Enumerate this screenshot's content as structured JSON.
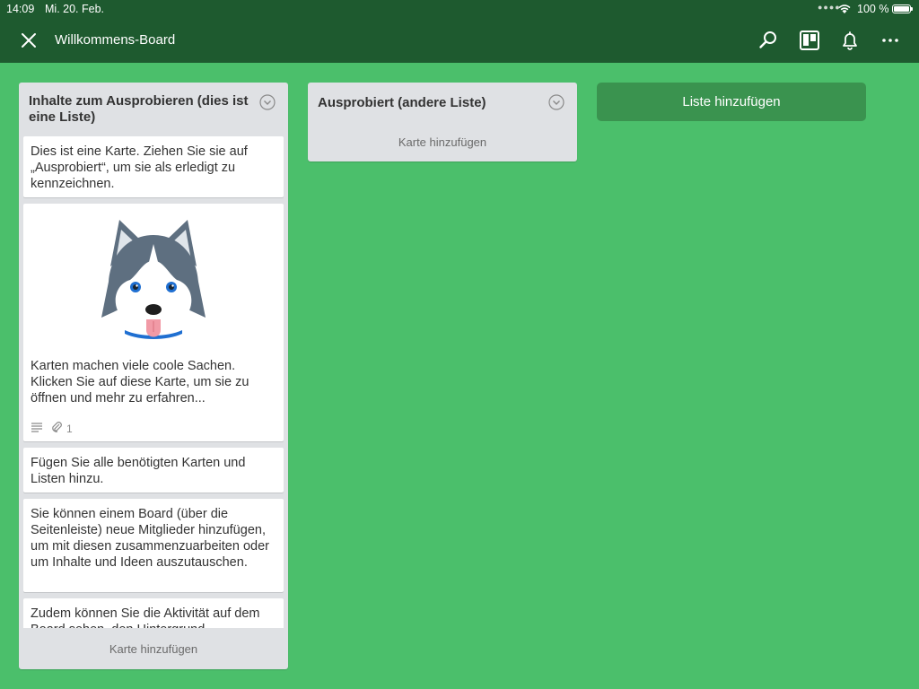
{
  "status_bar": {
    "time": "14:09",
    "date": "Mi. 20. Feb.",
    "battery": "100 %"
  },
  "header": {
    "title": "Willkommens-Board",
    "icons": [
      "close-icon",
      "search-icon",
      "board-view-icon",
      "bell-icon",
      "more-icon"
    ]
  },
  "lists": [
    {
      "title": "Inhalte zum Ausprobieren (dies ist eine Liste)",
      "cards": [
        {
          "text": "Dies ist eine Karte. Ziehen Sie sie auf „Ausprobiert“, um sie als erledigt zu kennzeichnen."
        },
        {
          "text": "Karten machen viele coole Sachen. Klicken Sie auf diese Karte, um sie zu öffnen und mehr zu erfahren...",
          "attachments": "1"
        },
        {
          "text": "Fügen Sie alle benötigten Karten und Listen hinzu."
        },
        {
          "text": "Sie können einem Board (über die Seitenleiste) neue Mitglieder hinzufügen, um mit diesen zusammenzuarbeiten oder um Inhalte und Ideen auszutauschen."
        },
        {
          "text": "Zudem können Sie die Aktivität auf dem Board sehen, den Hintergrund"
        }
      ],
      "add_card": "Karte hinzufügen"
    },
    {
      "title": "Ausprobiert (andere Liste)",
      "add_card": "Karte hinzufügen"
    }
  ],
  "add_list": "Liste hinzufügen",
  "colors": {
    "background": "#4bbf6b",
    "header": "#1e5a2f",
    "list": "#dfe1e4",
    "add_list_button": "#3a934f"
  }
}
